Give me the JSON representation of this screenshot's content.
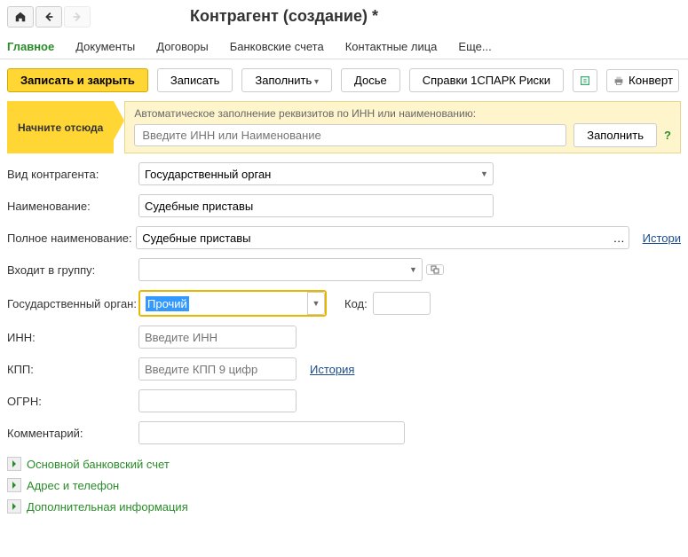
{
  "title": "Контрагент (создание) *",
  "tabs": {
    "main": "Главное",
    "documents": "Документы",
    "contracts": "Договоры",
    "bank": "Банковские счета",
    "contacts": "Контактные лица",
    "more": "Еще..."
  },
  "toolbar": {
    "save_close": "Записать и закрыть",
    "save": "Записать",
    "fill": "Заполнить",
    "dossier": "Досье",
    "spark": "Справки 1СПАРК Риски",
    "convert": "Конверт"
  },
  "hint": {
    "start": "Начните отсюда",
    "text": "Автоматическое заполнение реквизитов по ИНН или наименованию:",
    "placeholder": "Введите ИНН или Наименование",
    "fill_btn": "Заполнить"
  },
  "labels": {
    "type": "Вид контрагента:",
    "name": "Наименование:",
    "fullname": "Полное наименование:",
    "group": "Входит в группу:",
    "gov": "Государственный орган:",
    "code": "Код:",
    "inn": "ИНН:",
    "kpp": "КПП:",
    "ogrn": "ОГРН:",
    "comment": "Комментарий:"
  },
  "values": {
    "type": "Государственный орган",
    "name": "Судебные приставы",
    "fullname": "Судебные приставы",
    "group": "",
    "gov": "Прочий",
    "code": "",
    "inn_ph": "Введите ИНН",
    "kpp_ph": "Введите КПП 9 цифр",
    "ogrn": "",
    "comment": ""
  },
  "links": {
    "history": "История",
    "history2": "Истори"
  },
  "sections": {
    "bank": "Основной банковский счет",
    "address": "Адрес и телефон",
    "addinfo": "Дополнительная информация"
  }
}
